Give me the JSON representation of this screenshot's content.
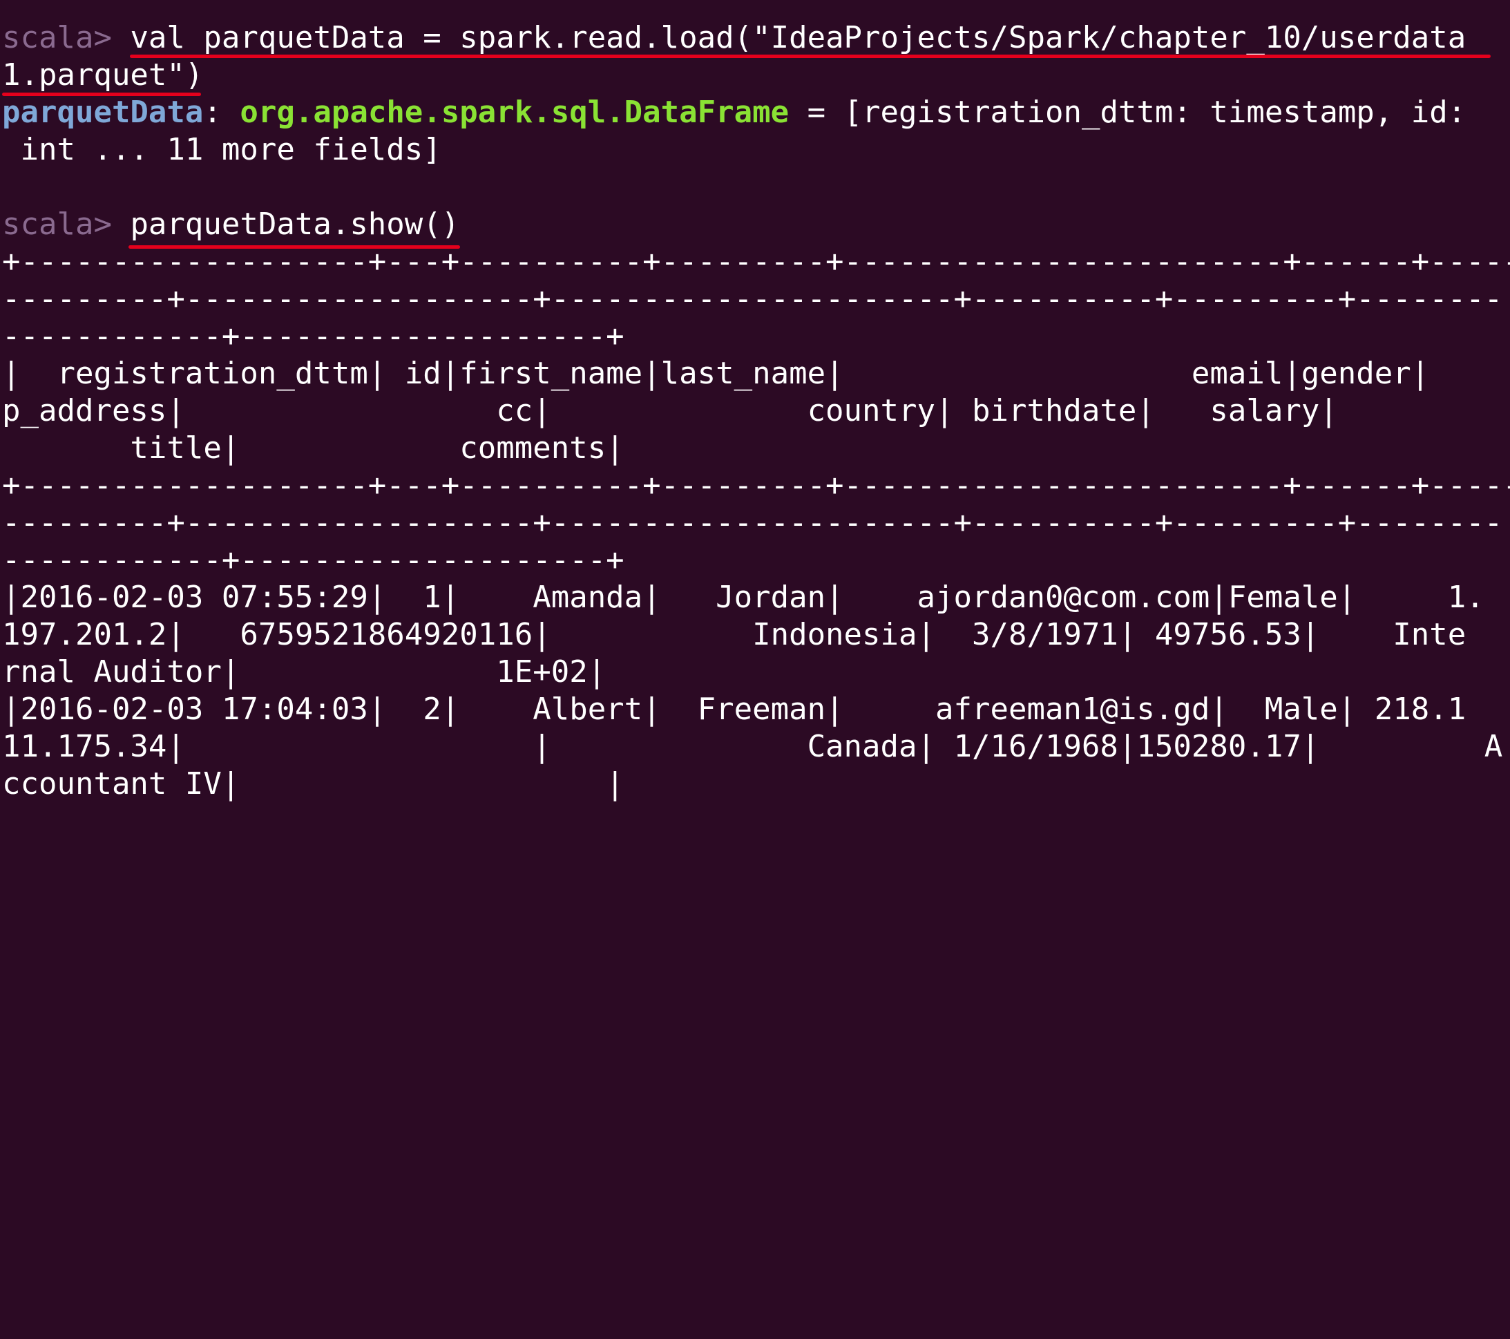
{
  "terminal": {
    "prompt": "scala> ",
    "command1_part1": "val parquetData = spark.read.load(\"IdeaProjects/Spark/chapter_10/userdata",
    "command1_part2": "1.parquet\")",
    "result_var": "parquetData",
    "result_colon": ": ",
    "result_type": "org.apache.spark.sql.DataFrame",
    "result_rest1": " = [registration_dttm: timestamp, id:",
    "result_rest2": " int ... 11 more fields]",
    "command2": "parquetData.show()",
    "output_lines": [
      "+-------------------+---+----------+---------+------------------------+------+------",
      "---------+-------------------+----------------------+----------+---------+--------",
      "------------+--------------------+",
      "|  registration_dttm| id|first_name|last_name|                   email|gender|     i",
      "p_address|                 cc|              country| birthdate|   salary|",
      "       title|            comments|",
      "+-------------------+---+----------+---------+------------------------+------+------",
      "---------+-------------------+----------------------+----------+---------+--------",
      "------------+--------------------+",
      "|2016-02-03 07:55:29|  1|    Amanda|   Jordan|    ajordan0@com.com|Female|     1.",
      "197.201.2|   6759521864920116|           Indonesia|  3/8/1971| 49756.53|    Inte",
      "rnal Auditor|              1E+02|",
      "|2016-02-03 17:04:03|  2|    Albert|  Freeman|     afreeman1@is.gd|  Male| 218.1",
      "11.175.34|                   |              Canada| 1/16/1968|150280.17|         A",
      "ccountant IV|                    |"
    ]
  },
  "colors": {
    "background": "#2c0a24",
    "prompt": "#8a6a8f",
    "variable": "#7fa8d8",
    "type": "#8ae234",
    "annotation_underline": "#e5001c"
  }
}
